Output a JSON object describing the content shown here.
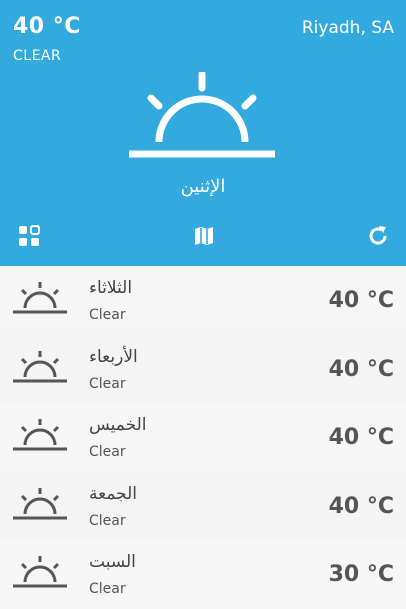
{
  "header": {
    "temperature": "40 °C",
    "condition": "CLEAR",
    "city": "Riyadh, SA",
    "day": "الإثنين"
  },
  "toolbar": {
    "grid_icon": "grid-icon",
    "map_icon": "map-icon",
    "refresh_icon": "refresh-icon"
  },
  "forecast": [
    {
      "day": "الثلاثاء",
      "condition": "Clear",
      "temperature": "40 °C",
      "icon": "sun-rising-icon"
    },
    {
      "day": "الأربعاء",
      "condition": "Clear",
      "temperature": "40 °C",
      "icon": "sun-rising-icon"
    },
    {
      "day": "الخميس",
      "condition": "Clear",
      "temperature": "40 °C",
      "icon": "sun-rising-icon"
    },
    {
      "day": "الجمعة",
      "condition": "Clear",
      "temperature": "40 °C",
      "icon": "sun-rising-icon"
    },
    {
      "day": "السبت",
      "condition": "Clear",
      "temperature": "30 °C",
      "icon": "sun-rising-icon"
    }
  ],
  "colors": {
    "header_bg": "#33aadf",
    "header_text": "#ffffff",
    "list_bg": "#f4f4f4",
    "list_text": "#555555"
  }
}
